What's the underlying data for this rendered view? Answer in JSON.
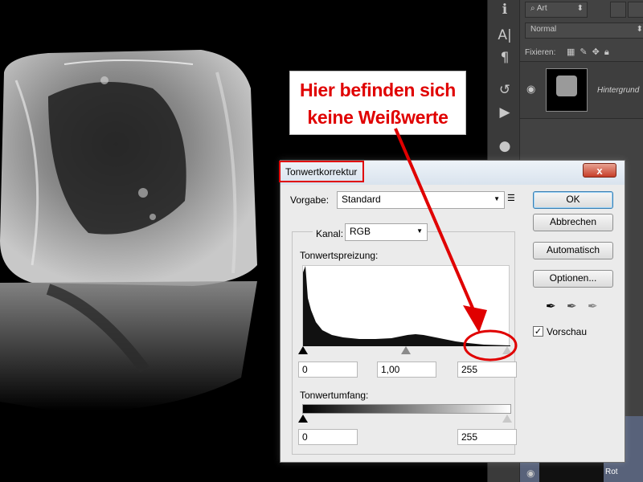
{
  "annotation": {
    "line1": "Hier befinden sich",
    "line2": "keine Weißwerte",
    "color": "#e00000"
  },
  "layers_panel": {
    "search_kind": "Art",
    "blend_mode": "Normal",
    "lock_label": "Fixieren:",
    "layer_name": "Hintergrund",
    "bottom_layer_name": "Rot"
  },
  "dialog": {
    "title": "Tonwertkorrektur",
    "close_label": "x",
    "preset_label": "Vorgabe:",
    "preset_value": "Standard",
    "channel_label": "Kanal:",
    "channel_value": "RGB",
    "input_levels_label": "Tonwertspreizung:",
    "input_black": "0",
    "input_gamma": "1,00",
    "input_white": "255",
    "output_levels_label": "Tonwertumfang:",
    "output_black": "0",
    "output_white": "255",
    "buttons": {
      "ok": "OK",
      "cancel": "Abbrechen",
      "auto": "Automatisch",
      "options": "Optionen..."
    },
    "preview_label": "Vorschau",
    "preview_checked": true
  },
  "colors": {
    "annotation_red": "#e00000",
    "dialog_bg": "#ebebeb",
    "panel_bg": "#424242"
  }
}
